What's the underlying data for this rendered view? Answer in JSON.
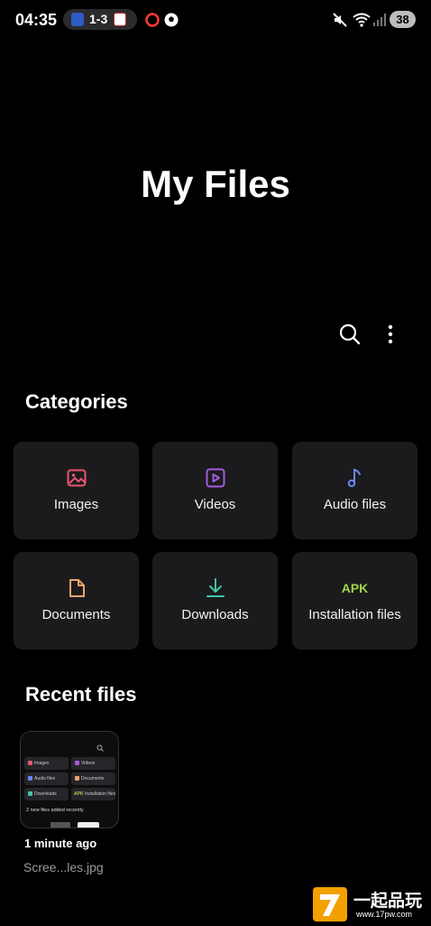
{
  "status_bar": {
    "time": "04:35",
    "score": "1-3",
    "battery": "38"
  },
  "page": {
    "title": "My Files"
  },
  "toolbar": {
    "search_icon": "search-icon",
    "more_icon": "more-vert-icon"
  },
  "categories": {
    "title": "Categories",
    "items": [
      {
        "label": "Images",
        "icon": "image-icon",
        "color": "#e8566f"
      },
      {
        "label": "Videos",
        "icon": "video-icon",
        "color": "#a45be0"
      },
      {
        "label": "Audio files",
        "icon": "music-note-icon",
        "color": "#6a86f0"
      },
      {
        "label": "Documents",
        "icon": "document-icon",
        "color": "#f0a468"
      },
      {
        "label": "Downloads",
        "icon": "download-icon",
        "color": "#3fc7a6"
      },
      {
        "label": "Installation files",
        "icon": "apk-icon",
        "color": "#a2d44a",
        "badge": "APK"
      }
    ]
  },
  "recent": {
    "title": "Recent files",
    "items": [
      {
        "time": "1 minute ago",
        "name": "Scree...les.jpg",
        "thumbnail": {
          "tiles": [
            "Images",
            "Videos",
            "Audio files",
            "Documents",
            "Downloads",
            "Installation files"
          ],
          "apk": "APK",
          "notice": "2 new files added recently"
        }
      }
    ]
  },
  "watermark": {
    "text": "一起品玩",
    "sub": "www.17pw.com"
  }
}
